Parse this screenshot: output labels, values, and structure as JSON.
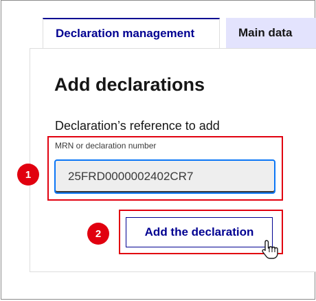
{
  "tabs": [
    {
      "label": "Declaration management",
      "active": true
    },
    {
      "label": "Main data",
      "active": false
    }
  ],
  "section": {
    "title": "Add declarations",
    "field_label": "Declaration’s reference to add",
    "hint": "MRN or declaration number",
    "input_value": "25FRD0000002402CR7",
    "button_label": "Add the declaration"
  },
  "annotations": {
    "step1": "1",
    "step2": "2"
  },
  "colors": {
    "accent_blue": "#000091",
    "highlight_red": "#e1000f",
    "inactive_tab_bg": "#e3e3fd",
    "focus_ring": "#0a76f6"
  },
  "icons": {
    "cursor": "pointer-hand-icon"
  }
}
